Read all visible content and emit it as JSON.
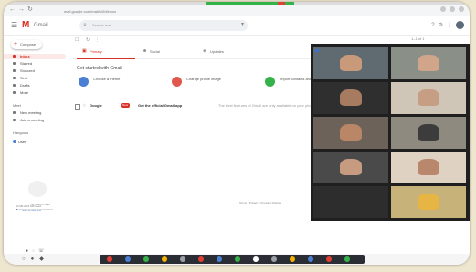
{
  "colors": {
    "gmail_red": "#d93025",
    "meet_green": "#36b24a",
    "meet_bg": "#1f1f1f",
    "link_blue": "#4a7fd4"
  },
  "browser": {
    "url": "mail.google.com/mail/u/0/#inbox",
    "nav_icons": [
      "back-icon",
      "forward-icon",
      "reload-icon"
    ]
  },
  "gmail": {
    "logo_text": "Gmail",
    "search_placeholder": "Search mail",
    "compose_label": "Compose",
    "nav": [
      {
        "label": "Inbox",
        "active": true
      },
      {
        "label": "Starred",
        "active": false
      },
      {
        "label": "Snoozed",
        "active": false
      },
      {
        "label": "Sent",
        "active": false
      },
      {
        "label": "Drafts",
        "active": false
      },
      {
        "label": "More",
        "active": false
      }
    ],
    "meet_heading": "Meet",
    "meet_items": [
      "New meeting",
      "Join a meeting"
    ],
    "hangouts_heading": "Hangouts",
    "hangouts_user": "User",
    "no_chats": "No recent chats",
    "no_chats_link": "Start a new one",
    "tabs": [
      {
        "label": "Primary",
        "icon": "inbox-icon",
        "active": true
      },
      {
        "label": "Social",
        "icon": "people-icon",
        "active": false
      },
      {
        "label": "Updates",
        "icon": "tag-icon",
        "active": false
      }
    ],
    "get_started_title": "Get started with Gmail",
    "get_started": [
      {
        "text": "Choose a theme",
        "color": "#4a7fd4"
      },
      {
        "text": "Change profile image",
        "color": "#e0584d"
      },
      {
        "text": "Import contacts and mail",
        "color": "#36b24a"
      }
    ],
    "email": {
      "sender": "Google",
      "badge": "New",
      "subject": "Get the official Gmail app",
      "snippet": "The best features of Gmail are only available on your phone and tablet with the official Gmail app."
    },
    "footer": "Terms · Privacy · Program Policies",
    "storage": "0 GB of 15 GB used",
    "storage_fraction": 0.03,
    "pagination": "1–1 of 1"
  },
  "meet": {
    "tiles": [
      {
        "name": "",
        "skin": "#c89a7a",
        "bg": "#5f6b70",
        "blue": true
      },
      {
        "name": "",
        "skin": "#d0a58a",
        "bg": "#8a8f88",
        "blue": false
      },
      {
        "name": "",
        "skin": "#a77b60",
        "bg": "#2f2f2f",
        "blue": false
      },
      {
        "name": "",
        "skin": "#c69e84",
        "bg": "#cfc6b8",
        "blue": false
      },
      {
        "name": "",
        "skin": "#b98668",
        "bg": "#6d6259",
        "blue": false
      },
      {
        "name": "",
        "skin": "#3c3c3c",
        "bg": "#8f8a80",
        "blue": false
      },
      {
        "name": "",
        "skin": "#c79b80",
        "bg": "#4a4a4a",
        "blue": false
      },
      {
        "name": "",
        "skin": "#b9876b",
        "bg": "#e0d2c2",
        "blue": false
      },
      {
        "name": "",
        "skin": "#2d2d2d",
        "bg": "#2d2d2d",
        "blue": false
      },
      {
        "name": "",
        "skin": "#e7b544",
        "bg": "#c7b27a",
        "blue": false
      }
    ]
  },
  "taskbar": {
    "apps": [
      "#e04033",
      "#4a7fd4",
      "#36b24a",
      "#f4b400",
      "#9aa0a6",
      "#e04033",
      "#4a7fd4",
      "#36b24a",
      "#ffffff",
      "#9aa0a6",
      "#f4b400",
      "#4a7fd4",
      "#e04033",
      "#36b24a"
    ]
  }
}
